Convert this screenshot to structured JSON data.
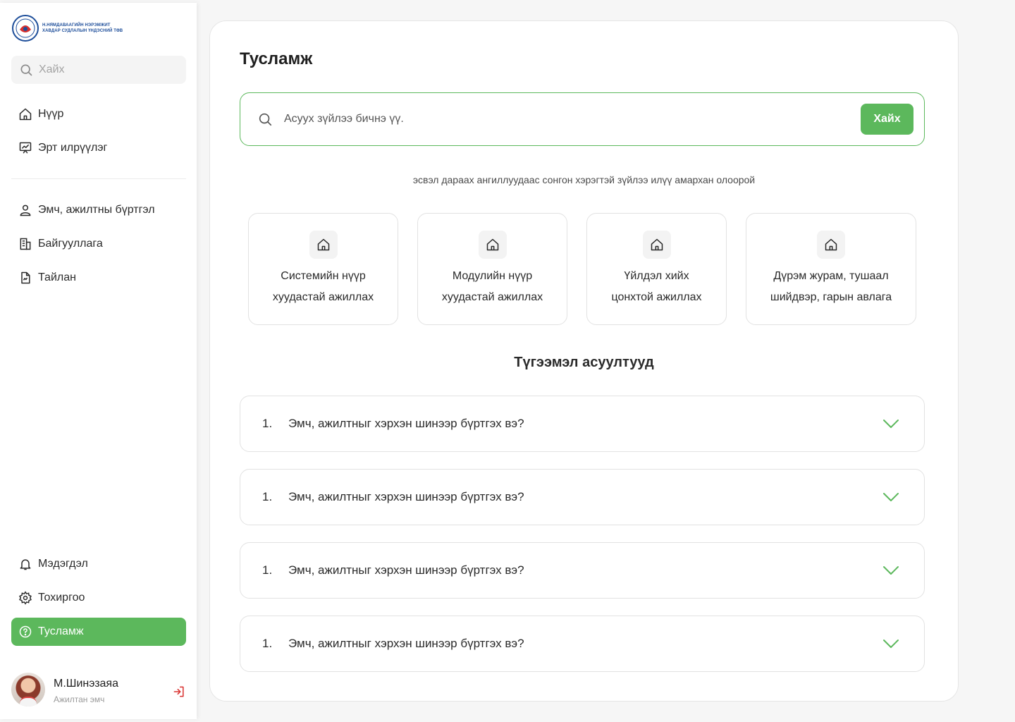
{
  "brand": {
    "logo_line1": "Н.НЯМДАВААГИЙН НЭРЭМЖИТ",
    "logo_line2": "ХАВДАР СУДЛАЛЫН ҮНДЭСНИЙ ТӨВ",
    "accent_color": "#5cb85c"
  },
  "sidebar": {
    "search_placeholder": "Хайх",
    "top_items": [
      {
        "label": "Нүүр",
        "icon": "home-icon"
      },
      {
        "label": "Эрт илрүүлэг",
        "icon": "chart-board-icon"
      }
    ],
    "middle_items": [
      {
        "label": "Эмч, ажилтны бүртгэл",
        "icon": "user-icon"
      },
      {
        "label": "Байгууллага",
        "icon": "building-icon"
      },
      {
        "label": "Тайлан",
        "icon": "report-icon"
      }
    ],
    "bottom_items": [
      {
        "label": "Мэдэгдэл",
        "icon": "bell-icon"
      },
      {
        "label": "Тохиргоо",
        "icon": "gear-icon"
      },
      {
        "label": "Тусламж",
        "icon": "help-icon",
        "active": true
      }
    ],
    "profile": {
      "name": "М.Шинэзаяа",
      "role": "Ажилтан эмч"
    }
  },
  "main": {
    "title": "Тусламж",
    "search": {
      "placeholder": "Асуух зүйлээ бичнэ үү.",
      "button_label": "Хайх"
    },
    "hint": "эсвэл дараах ангиллуудаас сонгон хэрэгтэй зүйлээ илүү амархан олоорой",
    "categories": [
      {
        "line1": "Системийн нүүр",
        "line2": "хуудастай ажиллах",
        "icon": "home-icon"
      },
      {
        "line1": "Модулийн нүүр",
        "line2": "хуудастай ажиллах",
        "icon": "home-icon"
      },
      {
        "line1": "Үйлдэл хийх",
        "line2": "цонхтой ажиллах",
        "icon": "home-icon"
      },
      {
        "line1": "Дүрэм журам, тушаал",
        "line2": "шийдвэр, гарын авлага",
        "icon": "home-icon"
      }
    ],
    "faq_title": "Түгээмэл асуултууд",
    "faqs": [
      {
        "number": "1.",
        "question": "Эмч, ажилтныг хэрхэн шинээр бүртгэх вэ?"
      },
      {
        "number": "1.",
        "question": "Эмч, ажилтныг хэрхэн шинээр бүртгэх вэ?"
      },
      {
        "number": "1.",
        "question": "Эмч, ажилтныг хэрхэн шинээр бүртгэх вэ?"
      },
      {
        "number": "1.",
        "question": "Эмч, ажилтныг хэрхэн шинээр бүртгэх вэ?"
      }
    ]
  }
}
